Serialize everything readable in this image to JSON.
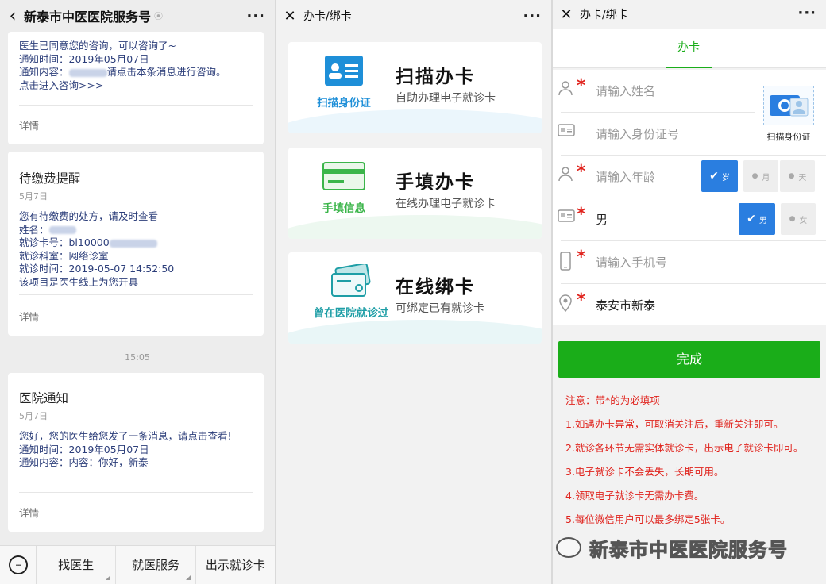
{
  "panel1": {
    "title": "新泰市中医医院服务号",
    "back_glyph": "‹",
    "more_glyph": "···",
    "msg1": {
      "line1": "医生已同意您的咨询，可以咨询了~",
      "line2": "通知时间：2019年05月07日",
      "line3_prefix": "通知内容：",
      "line3_suffix": "请点击本条消息进行咨询。",
      "line4": "点击进入咨询>>>",
      "detail": "详情"
    },
    "msg2": {
      "title": "待缴费提醒",
      "date": "5月7日",
      "line1": "您有待缴费的处方，请及时查看",
      "line2": "姓名：",
      "line3": "就诊卡号：bl10000",
      "line4": "就诊科室：网络诊室",
      "line5": "就诊时间：2019-05-07 14:52:50",
      "line6": "该项目是医生线上为您开具",
      "detail": "详情"
    },
    "time": "15:05",
    "msg3": {
      "title": "医院通知",
      "date": "5月7日",
      "line1": "您好，您的医生给您发了一条消息，请点击查看!",
      "line2": "通知时间：2019年05月07日",
      "line3": "通知内容：内容：你好，新泰",
      "detail": "详情"
    },
    "bottom": [
      "找医生",
      "就医服务",
      "出示就诊卡"
    ]
  },
  "panel2": {
    "title": "办卡/绑卡",
    "close_glyph": "✕",
    "more_glyph": "···",
    "cards": [
      {
        "icon_label": "扫描身份证",
        "title": "扫描办卡",
        "subtitle": "自助办理电子就诊卡",
        "color": "#1e8fd8",
        "wave": "#dbeefa"
      },
      {
        "icon_label": "手填信息",
        "title": "手填办卡",
        "subtitle": "在线办理电子就诊卡",
        "color": "#3bb54a",
        "wave": "#dff3e3"
      },
      {
        "icon_label": "曾在医院就诊过",
        "title": "在线绑卡",
        "subtitle": "可绑定已有就诊卡",
        "color": "#1e9ea6",
        "wave": "#d7eff1"
      }
    ]
  },
  "panel3": {
    "title": "办卡/绑卡",
    "close_glyph": "✕",
    "more_glyph": "···",
    "tab": "办卡",
    "name_placeholder": "请输入姓名",
    "id_placeholder": "请输入身份证号",
    "scan_label": "扫描身份证",
    "age_placeholder": "请输入年龄",
    "age_units": [
      "岁",
      "月",
      "天"
    ],
    "gender_value": "男",
    "gender_options": [
      "男",
      "女"
    ],
    "phone_placeholder": "请输入手机号",
    "address_value": "泰安市新泰",
    "required_mark": "*",
    "submit": "完成",
    "notes": [
      "注意：带*的为必填项",
      "1.如遇办卡异常，可取消关注后，重新关注即可。",
      "2.就诊各环节无需实体就诊卡，出示电子就诊卡即可。",
      "3.电子就诊卡不会丢失，长期可用。",
      "4.领取电子就诊卡无需办卡费。",
      "5.每位微信用户可以最多绑定5张卡。"
    ]
  },
  "watermark": "新泰市中医医院服务号",
  "colors": {
    "wechat_green": "#1aad19",
    "blue_selected": "#2a7ee0",
    "required_red": "#e0231d"
  }
}
